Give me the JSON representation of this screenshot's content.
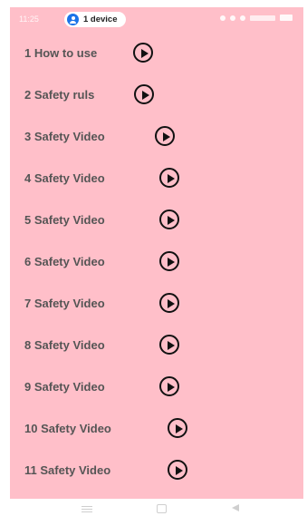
{
  "status_bar": {
    "time": "11:25",
    "device_label": "1 device"
  },
  "items": [
    {
      "label": "1 How to use"
    },
    {
      "label": "2 Safety ruls"
    },
    {
      "label": "3 Safety Video"
    },
    {
      "label": "4 Safety Video"
    },
    {
      "label": "5 Safety Video"
    },
    {
      "label": "6 Safety Video"
    },
    {
      "label": "7 Safety Video"
    },
    {
      "label": "8 Safety Video"
    },
    {
      "label": "9 Safety Video"
    },
    {
      "label": "10 Safety Video"
    },
    {
      "label": "11 Safety Video"
    }
  ],
  "colors": {
    "background": "#ffbfc9",
    "text": "#555555",
    "icon": "#111111"
  }
}
